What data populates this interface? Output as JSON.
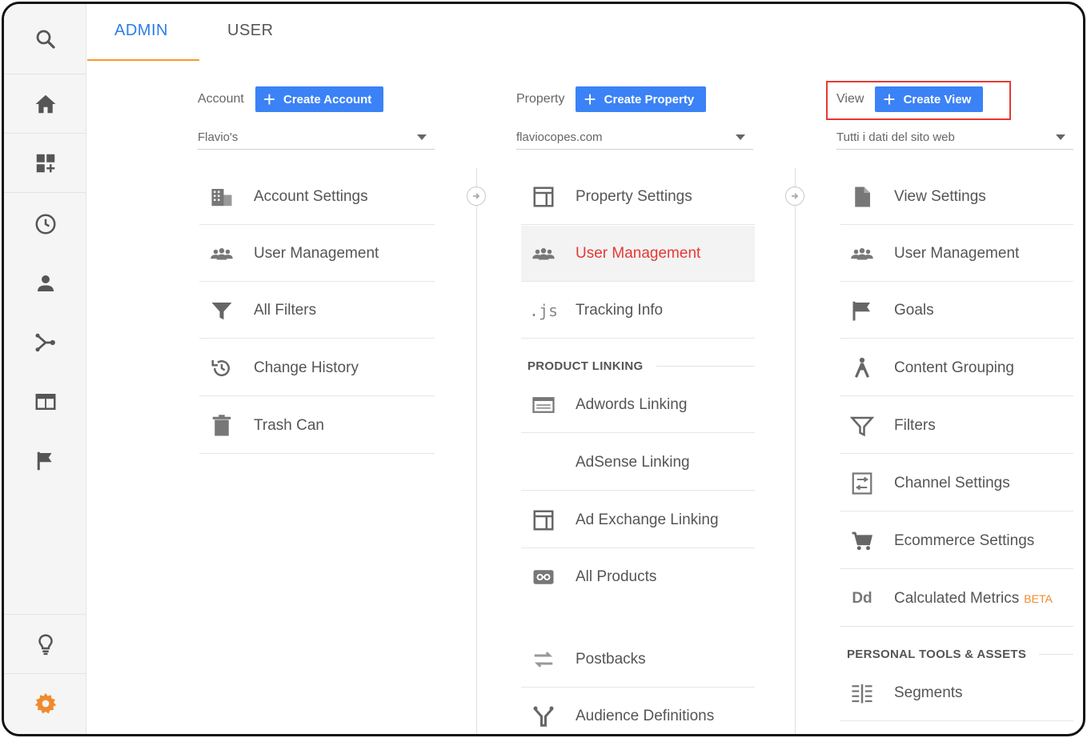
{
  "tabs": {
    "admin": "ADMIN",
    "user": "USER"
  },
  "accent_color": "#2b7de9",
  "account": {
    "label": "Account",
    "create_label": "Create Account",
    "selected": "Flavio's",
    "items": [
      {
        "label": "Account Settings",
        "icon": "building-icon"
      },
      {
        "label": "User Management",
        "icon": "users-icon"
      },
      {
        "label": "All Filters",
        "icon": "filter-icon"
      },
      {
        "label": "Change History",
        "icon": "history-icon"
      },
      {
        "label": "Trash Can",
        "icon": "trash-icon"
      }
    ]
  },
  "property": {
    "label": "Property",
    "create_label": "Create Property",
    "selected": "flaviocopes.com",
    "items": [
      {
        "label": "Property Settings",
        "icon": "window-icon"
      },
      {
        "label": "User Management",
        "icon": "users-icon"
      },
      {
        "label": "Tracking Info",
        "icon": "js-icon"
      }
    ],
    "section": "PRODUCT LINKING",
    "linking": [
      {
        "label": "Adwords Linking",
        "icon": "adwords-icon"
      },
      {
        "label": "AdSense Linking",
        "icon": ""
      },
      {
        "label": "Ad Exchange Linking",
        "icon": "window-icon"
      },
      {
        "label": "All Products",
        "icon": "link-icon"
      },
      {
        "label": "Postbacks",
        "icon": "postback-icon"
      },
      {
        "label": "Audience Definitions",
        "icon": "audience-icon"
      }
    ]
  },
  "view": {
    "label": "View",
    "create_label": "Create View",
    "selected": "Tutti i dati del sito web",
    "items": [
      {
        "label": "View Settings",
        "icon": "document-icon"
      },
      {
        "label": "User Management",
        "icon": "users-icon"
      },
      {
        "label": "Goals",
        "icon": "flag-icon"
      },
      {
        "label": "Content Grouping",
        "icon": "grouping-icon"
      },
      {
        "label": "Filters",
        "icon": "filter-icon"
      },
      {
        "label": "Channel Settings",
        "icon": "channel-icon"
      },
      {
        "label": "Ecommerce Settings",
        "icon": "cart-icon"
      },
      {
        "label": "Calculated Metrics",
        "icon": "dd-icon",
        "badge": "BETA"
      }
    ],
    "section": "PERSONAL TOOLS & ASSETS",
    "tools": [
      {
        "label": "Segments",
        "icon": "segments-icon"
      }
    ]
  },
  "rail": [
    "search-icon",
    "home-icon",
    "dashboard-icon",
    "clock-icon",
    "person-icon",
    "acquisition-icon",
    "behavior-icon",
    "flag-icon",
    "lightbulb-icon",
    "gear-icon"
  ]
}
